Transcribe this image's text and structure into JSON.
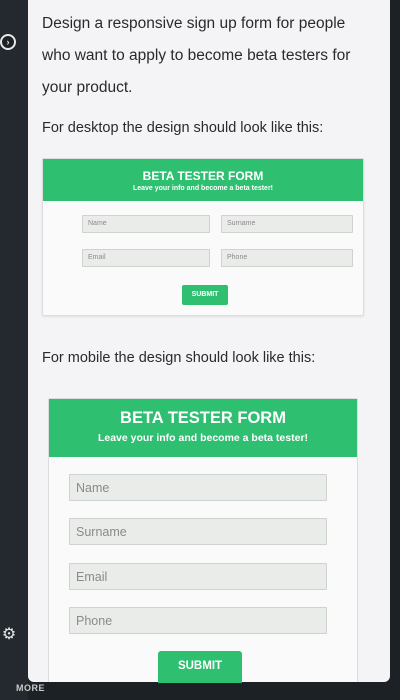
{
  "question": {
    "intro": "Design a responsive sign up form for people who want to apply to become beta testers for your product.",
    "desktop_heading": "For desktop the design should look like this:",
    "mobile_heading": "For mobile the design should look like this:"
  },
  "desktop_form": {
    "title": "BETA TESTER FORM",
    "subtitle": "Leave your info and become a beta tester!",
    "fields": {
      "name": "Name",
      "surname": "Surname",
      "email": "Email",
      "phone": "Phone"
    },
    "submit_label": "SUBMIT"
  },
  "mobile_form": {
    "title": "BETA TESTER FORM",
    "subtitle": "Leave your info and become a beta tester!",
    "fields": {
      "name": "Name",
      "surname": "Surname",
      "email": "Email",
      "phone": "Phone"
    },
    "submit_label": "SUBMIT"
  },
  "sidebar": {
    "more_label": "MORE",
    "top_icon": "circle-icon",
    "bottom_icon": "gear-icon"
  },
  "colors": {
    "accent": "#2fbf71",
    "background": "#1c2126",
    "card": "#f4f4f6"
  }
}
